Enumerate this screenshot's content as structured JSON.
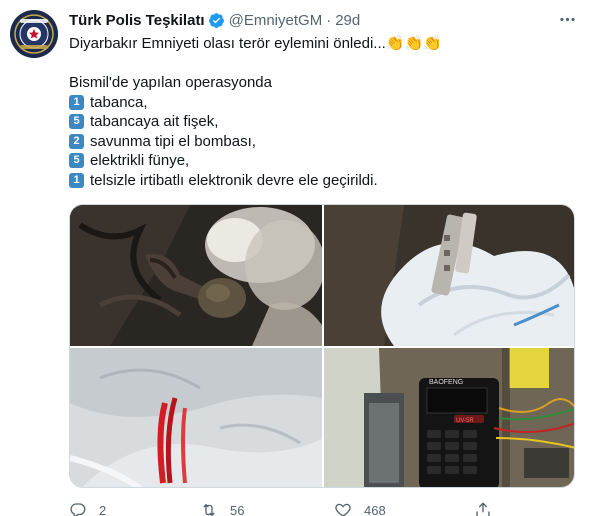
{
  "tweet": {
    "display_name": "Türk Polis Teşkilatı",
    "handle": "@EmniyetGM",
    "separator": "·",
    "time": "29d",
    "headline": "Diyarbakır Emniyeti olası terör eylemini önledi...",
    "claps": "👏👏👏",
    "intro": "Bismil'de yapılan operasyonda",
    "items": [
      {
        "num": "1",
        "text": "tabanca,"
      },
      {
        "num": "5",
        "text": "tabancaya ait fişek,"
      },
      {
        "num": "2",
        "text": "savunma tipi el bombası,"
      },
      {
        "num": "5",
        "text": "elektrikli fünye,"
      },
      {
        "num": "1",
        "text": "telsizle irtibatlı elektronik devre ele geçirildi."
      }
    ]
  },
  "radio_labels": {
    "brand": "BAOFENG",
    "display": "UV-5R"
  },
  "stats": {
    "replies": "2",
    "retweets": "56",
    "likes": "468"
  },
  "colors": {
    "verified": "#1d9bf0",
    "muted": "#536471",
    "keycap": "#3b88c3"
  },
  "icons": [
    "verified-badge-icon",
    "more-icon",
    "reply-icon",
    "retweet-icon",
    "like-icon",
    "share-icon"
  ]
}
